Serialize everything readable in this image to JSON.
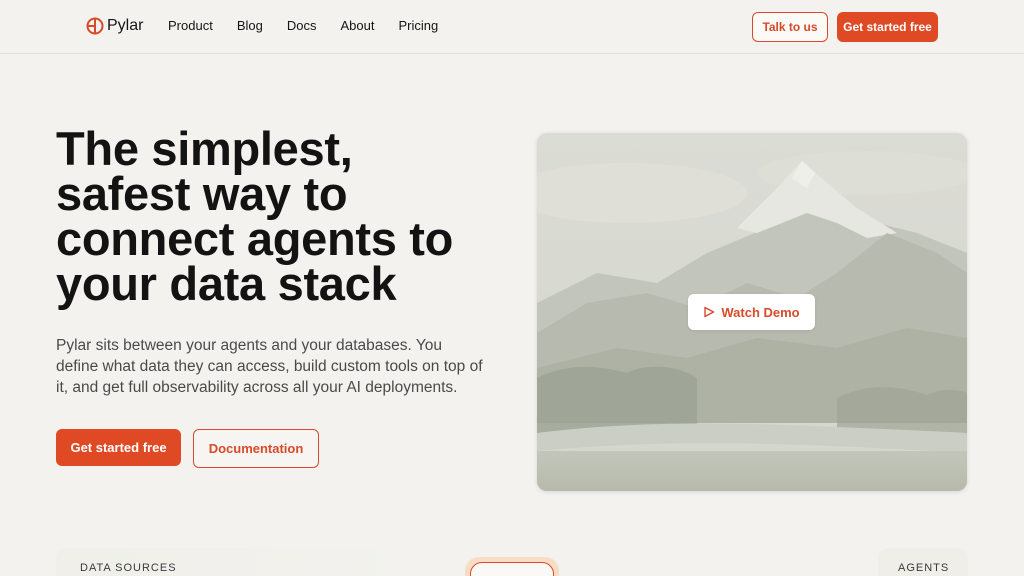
{
  "brand": {
    "name": "Pylar",
    "logo_icon": "pylar-logo-icon",
    "accent": "#df4a25"
  },
  "nav": {
    "items": [
      "Product",
      "Blog",
      "Docs",
      "About",
      "Pricing"
    ]
  },
  "header_actions": {
    "talk": "Talk to us",
    "get_started": "Get started free"
  },
  "hero": {
    "title": "The simplest, safest way to connect agents to your data stack",
    "subtitle": "Pylar sits between your agents and your databases. You define what data they can access, build custom tools on top of it, and get full observability across all your AI deployments.",
    "primary_cta": "Get started free",
    "secondary_cta": "Documentation"
  },
  "video": {
    "button_label": "Watch Demo",
    "play_icon": "play-icon"
  },
  "sections": {
    "left_label": "DATA SOURCES",
    "right_label": "AGENTS"
  }
}
